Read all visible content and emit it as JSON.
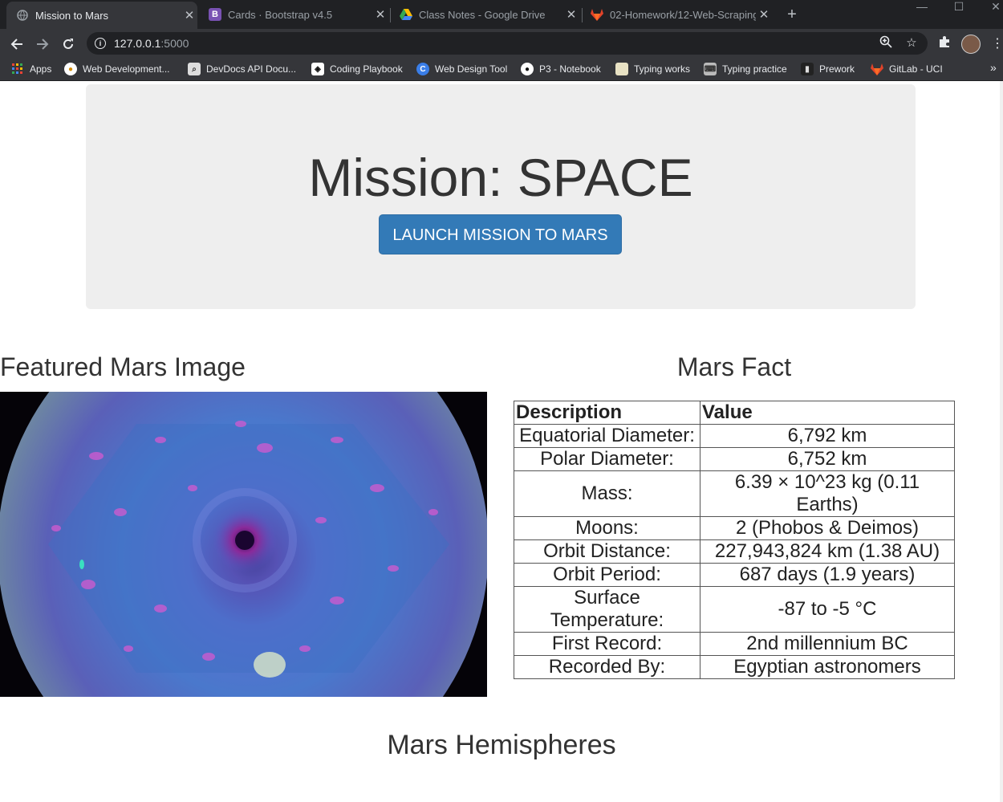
{
  "browser": {
    "tabs": [
      {
        "title": "Mission to Mars",
        "active": true
      },
      {
        "title": "Cards · Bootstrap v4.5",
        "active": false
      },
      {
        "title": "Class Notes - Google Drive",
        "active": false
      },
      {
        "title": "02-Homework/12-Web-Scraping",
        "active": false
      }
    ],
    "url_host": "127.0.0.1",
    "url_port": ":5000",
    "bookmarks": [
      "Apps",
      "Web Development...",
      "DevDocs API Docu...",
      "Coding Playbook",
      "Web Design Tool",
      "P3 - Notebook",
      "Typing works",
      "Typing practice",
      "Prework",
      "GitLab - UCI"
    ]
  },
  "jumbotron": {
    "title": "Mission: SPACE",
    "button_label": "LAUNCH MISSION TO MARS"
  },
  "featured": {
    "title": "Featured Mars Image"
  },
  "facts": {
    "title": "Mars Fact",
    "headers": [
      "Description",
      "Value"
    ],
    "rows": [
      {
        "description": "Equatorial Diameter:",
        "value": "6,792 km"
      },
      {
        "description": "Polar Diameter:",
        "value": "6,752 km"
      },
      {
        "description": "Mass:",
        "value": "6.39 × 10^23 kg (0.11 Earths)"
      },
      {
        "description": "Moons:",
        "value": "2 (Phobos & Deimos)"
      },
      {
        "description": "Orbit Distance:",
        "value": "227,943,824 km (1.38 AU)"
      },
      {
        "description": "Orbit Period:",
        "value": "687 days (1.9 years)"
      },
      {
        "description": "Surface Temperature:",
        "value": "-87 to -5 °C"
      },
      {
        "description": "First Record:",
        "value": "2nd millennium BC"
      },
      {
        "description": "Recorded By:",
        "value": "Egyptian astronomers"
      }
    ]
  },
  "hemispheres": {
    "title": "Mars Hemispheres"
  },
  "colors": {
    "accent": "#337ab7",
    "jumbotron_bg": "#eeeeee",
    "chrome_dark": "#202124"
  }
}
